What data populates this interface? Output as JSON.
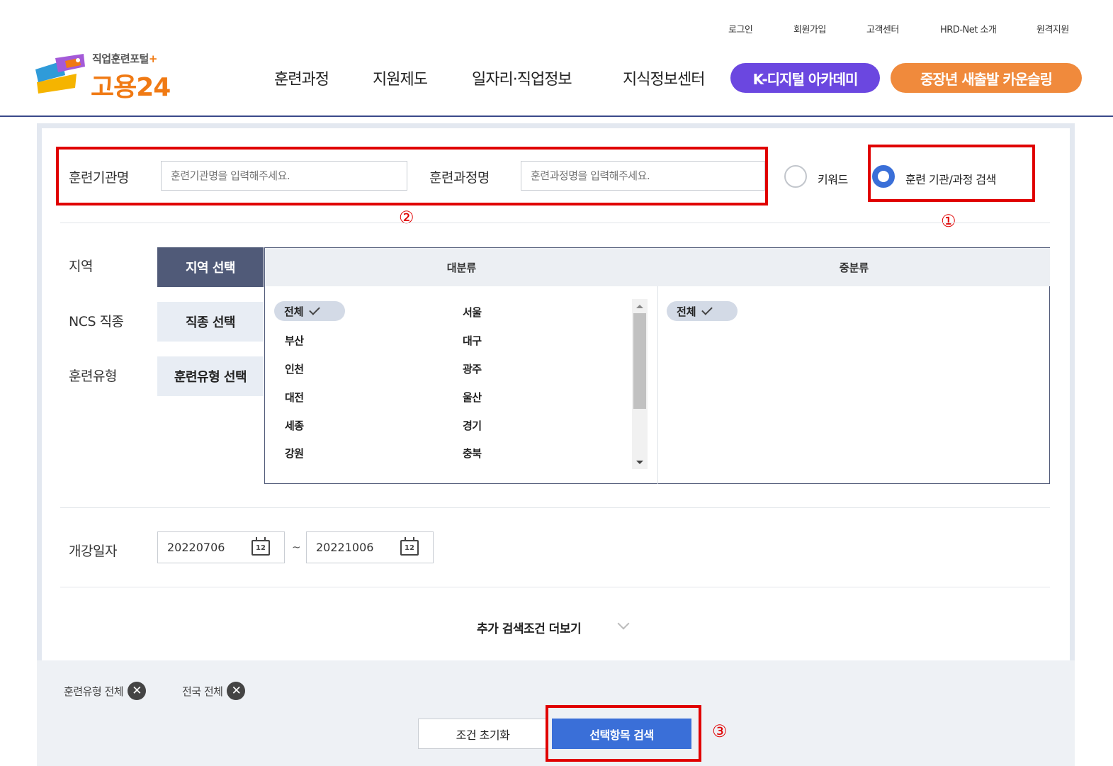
{
  "util_links": [
    "로그인",
    "회원가입",
    "고객센터",
    "HRD-Net 소개",
    "원격지원"
  ],
  "logo": {
    "sub": "직업훈련포털",
    "plus": "+",
    "main": "고용24"
  },
  "gnb": [
    "훈련과정",
    "지원제도",
    "일자리·직업정보",
    "지식정보센터"
  ],
  "pills": {
    "digital": "K-디지털 아카데미",
    "counsel": "중장년 새출발 카운슬링"
  },
  "search": {
    "org_label": "훈련기관명",
    "org_placeholder": "훈련기관명을 입력해주세요.",
    "course_label": "훈련과정명",
    "course_placeholder": "훈련과정명을 입력해주세요.",
    "radio_keyword": "키워드",
    "radio_org_course": "훈련 기관/과정 검색",
    "selected_radio": "훈련 기관/과정 검색"
  },
  "annotations": {
    "a1": "①",
    "a2": "②",
    "a3": "③"
  },
  "filters": {
    "region_label": "지역",
    "ncs_label": "NCS 직종",
    "type_label": "훈련유형",
    "region_btn": "지역 선택",
    "ncs_btn": "직종 선택",
    "type_btn": "훈련유형 선택"
  },
  "region_table": {
    "col_major": "대분류",
    "col_mid": "중분류",
    "major_selected": "전체",
    "major_left": [
      "부산",
      "인천",
      "대전",
      "세종",
      "강원"
    ],
    "major_right": [
      "서울",
      "대구",
      "광주",
      "울산",
      "경기",
      "충북"
    ],
    "mid_selected": "전체"
  },
  "date": {
    "label": "개강일자",
    "start": "20220706",
    "end": "20221006",
    "separator": "~",
    "calendar_day": "12"
  },
  "more_label": "추가 검색조건 더보기",
  "tags": [
    "훈련유형 전체",
    "전국 전체"
  ],
  "tag_close": "✕",
  "buttons": {
    "reset": "조건 초기화",
    "search": "선택항목 검색"
  },
  "colors": {
    "accent": "#3a6fd8",
    "brand_orange": "#f07a14",
    "digital_purple": "#6b47e0",
    "annotation_red": "#e00000",
    "active_nav": "#505a78"
  }
}
